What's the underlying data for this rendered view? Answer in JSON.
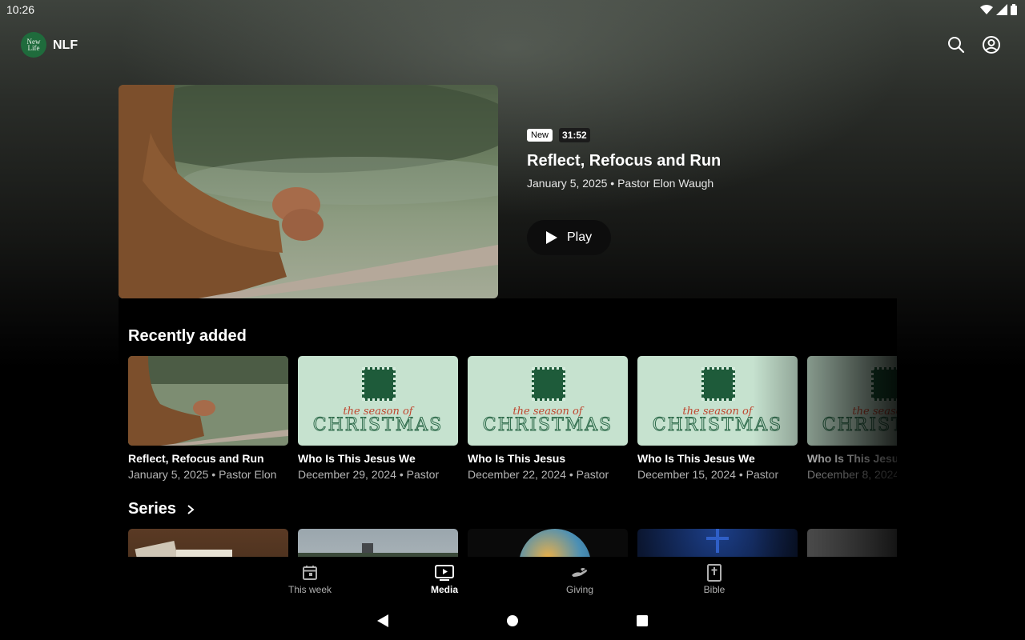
{
  "status_bar": {
    "time": "10:26"
  },
  "app": {
    "brand": "NLF",
    "logo_text_line1": "New",
    "logo_text_line2": "Life"
  },
  "hero": {
    "badge_new": "New",
    "duration": "31:52",
    "title": "Reflect, Refocus and Run",
    "subtitle": "January 5, 2025 • Pastor Elon Waugh",
    "play_label": "Play"
  },
  "recently_added": {
    "title": "Recently added",
    "items": [
      {
        "title": "Reflect, Refocus and Run",
        "subtitle": "January 5, 2025 • Pastor Elon",
        "thumb": "lake-hands"
      },
      {
        "title": "Who Is This Jesus We",
        "subtitle": "December 29, 2024 • Pastor",
        "thumb": "christmas"
      },
      {
        "title": "Who Is This Jesus",
        "subtitle": "December 22, 2024 • Pastor",
        "thumb": "christmas"
      },
      {
        "title": "Who Is This Jesus We",
        "subtitle": "December 15, 2024 • Pastor",
        "thumb": "christmas"
      },
      {
        "title": "Who Is This Jesus",
        "subtitle": "December 8, 2024",
        "thumb": "christmas"
      }
    ],
    "christmas_script": "the season of",
    "christmas_word": "CHRISTMAS"
  },
  "series": {
    "title": "Series"
  },
  "bottom_nav": {
    "items": [
      {
        "label": "This week",
        "icon": "calendar-icon"
      },
      {
        "label": "Media",
        "icon": "tv-play-icon",
        "active": true
      },
      {
        "label": "Giving",
        "icon": "hand-giving-icon"
      },
      {
        "label": "Bible",
        "icon": "bible-icon"
      }
    ]
  },
  "colors": {
    "accent_green": "#1e5b3a",
    "christmas_bg": "#c6e2cf",
    "script_red": "#c0462f"
  }
}
